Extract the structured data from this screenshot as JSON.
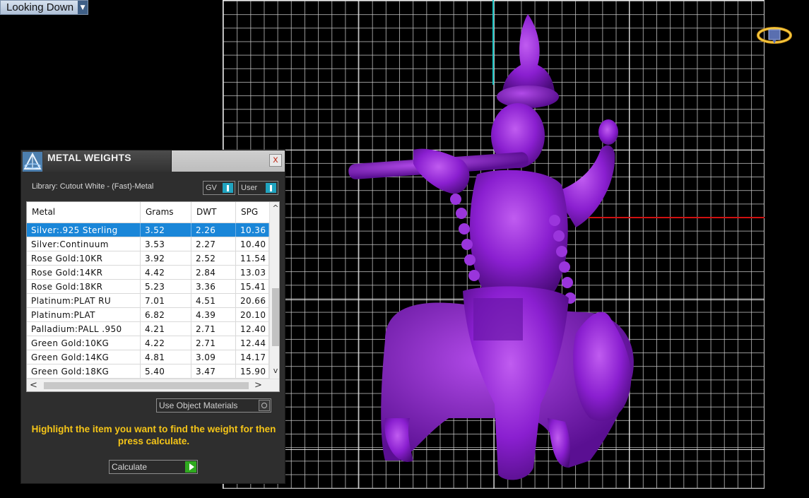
{
  "viewport": {
    "view_label": "Looking Down",
    "colors": {
      "background": "#000000",
      "grid": "#cdcdcd",
      "axis_y": "#19c6c6",
      "axis_x": "#d01010",
      "model": "#8a1fd0"
    }
  },
  "icons": {
    "view_dropdown": "chevron-down-icon",
    "nav_cube": "view-cube-icon",
    "panel_logo": "matrix-pyramid-icon",
    "close": "close-icon"
  },
  "panel": {
    "title": "METAL WEIGHTS",
    "close_label": "x",
    "library_label": "Library: Cutout White - (Fast)-Metal",
    "gv_label": "GV",
    "user_label": "User",
    "columns": [
      "Metal",
      "Grams",
      "DWT",
      "SPG"
    ],
    "rows": [
      [
        "Silver:.925 Sterling",
        "3.52",
        "2.26",
        "10.36"
      ],
      [
        "Silver:Continuum",
        "3.53",
        "2.27",
        "10.40"
      ],
      [
        "Rose Gold:10KR",
        "3.92",
        "2.52",
        "11.54"
      ],
      [
        "Rose Gold:14KR",
        "4.42",
        "2.84",
        "13.03"
      ],
      [
        "Rose Gold:18KR",
        "5.23",
        "3.36",
        "15.41"
      ],
      [
        "Platinum:PLAT RU",
        "7.01",
        "4.51",
        "20.66"
      ],
      [
        "Platinum:PLAT",
        "6.82",
        "4.39",
        "20.10"
      ],
      [
        "Palladium:PALL .950",
        "4.21",
        "2.71",
        "12.40"
      ],
      [
        "Green Gold:10KG",
        "4.22",
        "2.71",
        "12.44"
      ],
      [
        "Green Gold:14KG",
        "4.81",
        "3.09",
        "14.17"
      ],
      [
        "Green Gold:18KG",
        "5.40",
        "3.47",
        "15.90"
      ]
    ],
    "selected_row": 0,
    "use_object_materials_label": "Use Object Materials",
    "instructions": "Highlight the item you want to find the weight for then press calculate.",
    "calculate_label": "Calculate",
    "colors": {
      "panel_bg": "#2e2e2e",
      "selection": "#1a86d8",
      "instructions": "#f5c518",
      "calculate_knob": "#2faa1f",
      "toggle_knob": "#20a4c0"
    }
  }
}
